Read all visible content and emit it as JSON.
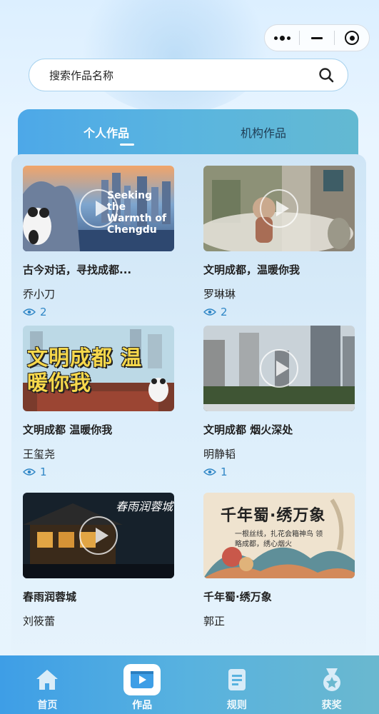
{
  "search": {
    "placeholder": "搜索作品名称"
  },
  "tabs": [
    {
      "label": "个人作品",
      "active": true
    },
    {
      "label": "机构作品",
      "active": false
    }
  ],
  "works": [
    {
      "title": "古今对话，寻找成都...",
      "author": "乔小刀",
      "views": "2",
      "thumb_text": "Seeking the Warmth of Chengdu"
    },
    {
      "title": "文明成都，温暖你我",
      "author": "罗琳琳",
      "views": "2",
      "thumb_text": ""
    },
    {
      "title": "文明成都 温暖你我",
      "author": "王玺尧",
      "views": "1",
      "thumb_text": "文明成都 温暖你我"
    },
    {
      "title": "文明成都 烟火深处",
      "author": "明静韬",
      "views": "1",
      "thumb_text": ""
    },
    {
      "title": "春雨润蓉城",
      "author": "刘筱蕾",
      "views": "",
      "thumb_text": "春雨润蓉城"
    },
    {
      "title": "千年蜀·绣万象",
      "author": "郭正",
      "views": "",
      "thumb_text": "千年蜀·绣万象",
      "thumb_subtext": "一根丝线，扎花会箱神鸟 领略成都，绣心烟火"
    }
  ],
  "nav": [
    {
      "label": "首页",
      "icon": "home-icon",
      "active": false
    },
    {
      "label": "作品",
      "icon": "video-icon",
      "active": true
    },
    {
      "label": "规则",
      "icon": "document-icon",
      "active": false
    },
    {
      "label": "获奖",
      "icon": "medal-icon",
      "active": false
    }
  ],
  "colors": {
    "accent": "#4da8e8",
    "view_count": "#2f86c6",
    "nav_bg": "#58b2df"
  }
}
